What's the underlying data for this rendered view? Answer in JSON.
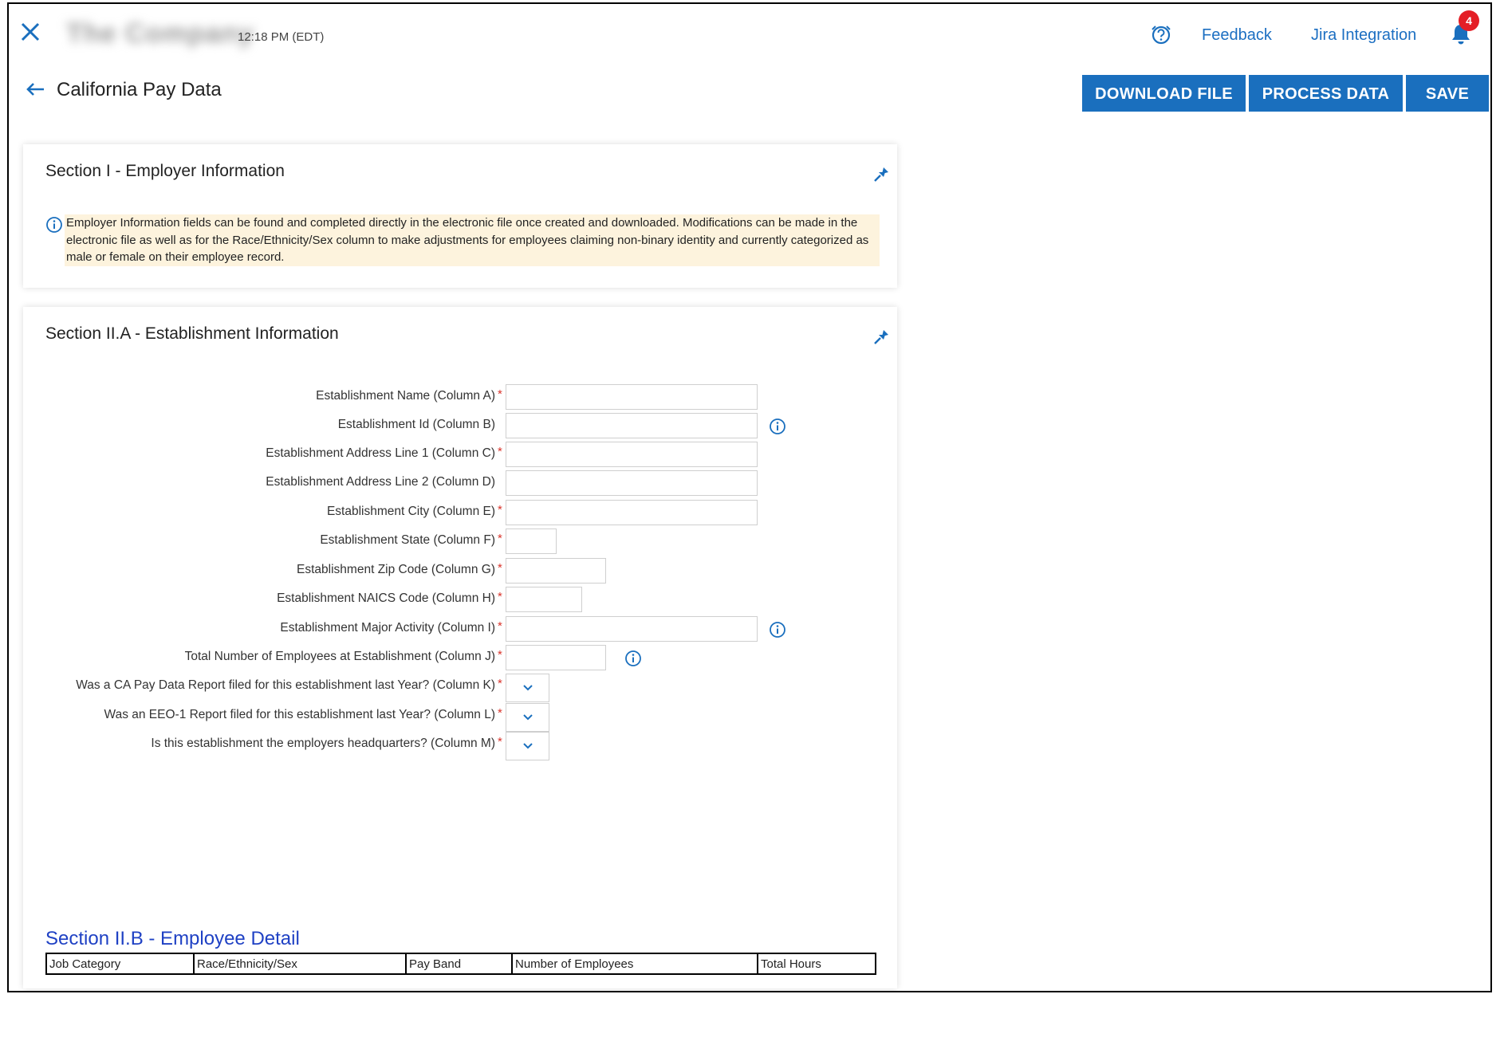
{
  "header": {
    "app_title": "The Company",
    "time": "12:18 PM (EDT)",
    "links": {
      "feedback": "Feedback",
      "jira": "Jira Integration"
    },
    "notifications_count": "4"
  },
  "page": {
    "title": "California Pay Data",
    "buttons": {
      "download": "DOWNLOAD FILE",
      "process": "PROCESS DATA",
      "save": "SAVE"
    }
  },
  "section1": {
    "title": "Section I - Employer Information",
    "notice": "Employer Information fields can be found and completed directly in the electronic file once created and downloaded. Modifications can be made in the electronic file as well as for the Race/Ethnicity/Sex column to make adjustments for employees claiming non-binary identity and currently categorized as male or female on their employee record."
  },
  "section2a": {
    "title": "Section II.A - Establishment Information",
    "fields": {
      "name": {
        "label": "Establishment Name (Column A)",
        "value": ""
      },
      "id": {
        "label": "Establishment Id (Column B)",
        "value": ""
      },
      "addr1": {
        "label": "Establishment Address Line 1 (Column C)",
        "value": ""
      },
      "addr2": {
        "label": "Establishment Address Line 2 (Column D)",
        "value": ""
      },
      "city": {
        "label": "Establishment City (Column E)",
        "value": ""
      },
      "state": {
        "label": "Establishment State (Column F)",
        "value": ""
      },
      "zip": {
        "label": "Establishment Zip Code (Column G)",
        "value": ""
      },
      "naics": {
        "label": "Establishment NAICS Code (Column H)",
        "value": ""
      },
      "activity": {
        "label": "Establishment Major Activity (Column I)",
        "value": ""
      },
      "employees": {
        "label": "Total Number of Employees at Establishment (Column J)",
        "value": ""
      },
      "ca_report": {
        "label": "Was a CA Pay Data Report filed for this establishment last Year? (Column K)",
        "selected": ""
      },
      "eeo1": {
        "label": "Was an EEO-1 Report filed for this establishment last Year? (Column L)",
        "selected": ""
      },
      "hq": {
        "label": "Is this establishment the employers headquarters? (Column M)",
        "selected": ""
      }
    },
    "required_mark": "*"
  },
  "section2b": {
    "title": "Section II.B - Employee Detail",
    "columns": [
      "Job Category",
      "Race/Ethnicity/Sex",
      "Pay Band",
      "Number of Employees",
      "Total Hours"
    ]
  },
  "colors": {
    "accent": "#1a6fbe",
    "link": "#1c6fc2",
    "section_b_title": "#1f41c4",
    "notice_bg": "#fdf3dd",
    "badge": "#e41e26",
    "required": "#d9332b"
  },
  "icons": [
    "close-icon",
    "help-icon",
    "bell-icon",
    "back-arrow-icon",
    "collapse-icon",
    "info-icon",
    "chevron-down-icon"
  ]
}
